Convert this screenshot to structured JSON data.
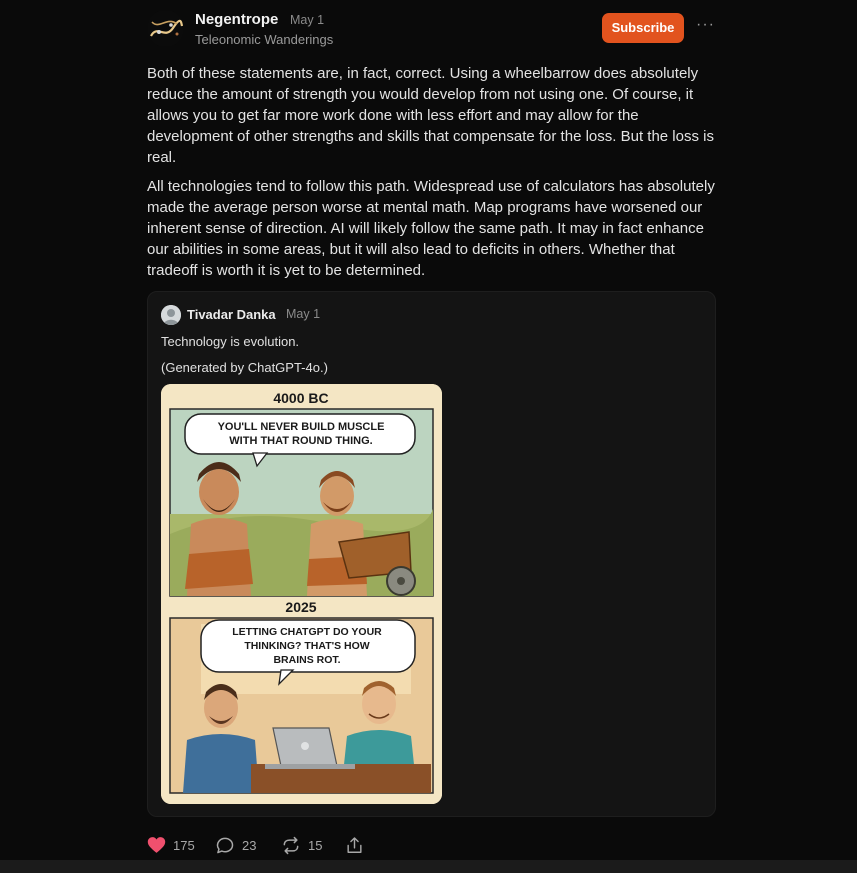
{
  "post": {
    "author": "Negentrope",
    "date": "May 1",
    "publication": "Teleonomic Wanderings",
    "subscribe_label": "Subscribe",
    "more_label": "···",
    "paragraphs": [
      "Both of these statements are, in fact, correct. Using a wheelbarrow does absolutely reduce the amount of strength you would develop from not using one. Of course, it allows you to get far more work done with less effort and may allow for the development of other strengths and skills that compensate for the loss. But the loss is real.",
      "All technologies tend to follow this path. Widespread use of calculators has absolutely made the average person worse at mental math. Map programs have worsened our inherent sense of direction. AI will likely follow the same path. It may in fact enhance our abilities in some areas, but it will also lead to deficits in others. Whether that tradeoff is worth it is yet to be determined."
    ]
  },
  "quote": {
    "author": "Tivadar Danka",
    "date": "May 1",
    "text": "Technology is evolution.",
    "caption": "(Generated by ChatGPT-4o.)",
    "comic": {
      "panel1_title": "4000 BC",
      "panel1_line1": "YOU'LL NEVER BUILD MUSCLE",
      "panel1_line2": "WITH THAT ROUND THING.",
      "panel2_title": "2025",
      "panel2_line1": "LETTING CHATGPT DO YOUR",
      "panel2_line2": "THINKING? THAT'S HOW",
      "panel2_line3": "BRAINS ROT."
    }
  },
  "actions": {
    "likes": "175",
    "comments": "23",
    "restacks": "15"
  },
  "colors": {
    "background": "#0a0a0a",
    "accent": "#e2531e",
    "like": "#f0506e"
  },
  "icons": [
    "more-icon",
    "heart-icon",
    "comment-icon",
    "restack-icon",
    "share-icon"
  ]
}
